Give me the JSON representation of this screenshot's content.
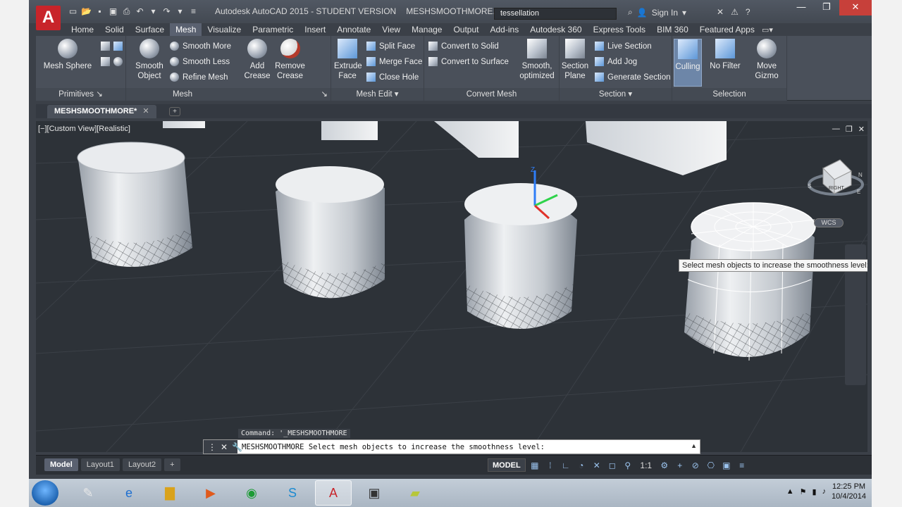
{
  "app": {
    "title": "Autodesk AutoCAD 2015 - STUDENT VERSION",
    "document": "MESHSMOOTHMORE.dwg",
    "logo_letter": "A",
    "search_value": "tessellation",
    "sign_in": "Sign In",
    "help": "?"
  },
  "ribbon_tabs": [
    "Home",
    "Solid",
    "Surface",
    "Mesh",
    "Visualize",
    "Parametric",
    "Insert",
    "Annotate",
    "View",
    "Manage",
    "Output",
    "Add-ins",
    "Autodesk 360",
    "Express Tools",
    "BIM 360",
    "Featured Apps"
  ],
  "ribbon": {
    "primitives": {
      "title": "Primitives",
      "mesh_sphere": "Mesh Sphere"
    },
    "mesh": {
      "title": "Mesh",
      "smooth_object": "Smooth Object",
      "smooth_more": "Smooth More",
      "smooth_less": "Smooth Less",
      "refine_mesh": "Refine Mesh"
    },
    "mesh_edit": {
      "title": "Mesh Edit",
      "add_crease": "Add Crease",
      "remove_crease": "Remove Crease",
      "extrude_face": "Extrude Face",
      "split_face": "Split Face",
      "merge_face": "Merge Face",
      "close_hole": "Close Hole"
    },
    "convert_mesh": {
      "title": "Convert Mesh",
      "convert_solid": "Convert to Solid",
      "convert_surface": "Convert to Surface",
      "smooth_optimized": "Smooth, optimized"
    },
    "section": {
      "title": "Section",
      "section_plane": "Section Plane",
      "live_section": "Live Section",
      "add_jog": "Add Jog",
      "generate_section": "Generate Section"
    },
    "selection": {
      "title": "Selection",
      "culling": "Culling",
      "no_filter": "No Filter",
      "move_gizmo": "Move Gizmo"
    }
  },
  "doc_tab": "MESHSMOOTHMORE*",
  "viewport": {
    "label": "[−][Custom View][Realistic]",
    "viewcube_face": "RIGHT",
    "wcs": "WCS",
    "tooltip": "Select mesh objects to increase the smoothness level:"
  },
  "command": {
    "history": "Command:  '_MESHSMOOTHMORE",
    "current": "MESHSMOOTHMORE",
    "prompt": "Select mesh objects to increase the smoothness level:"
  },
  "layouts": [
    "Model",
    "Layout1",
    "Layout2"
  ],
  "status": {
    "model": "MODEL",
    "scale": "1:1"
  },
  "taskbar": {
    "time": "12:25 PM",
    "date": "10/4/2014"
  },
  "colors": {
    "app_red": "#c8242a",
    "viewport_bg": "#2d3238",
    "ribbon_bg": "#4a505a",
    "active_tab": "#5a6170"
  }
}
